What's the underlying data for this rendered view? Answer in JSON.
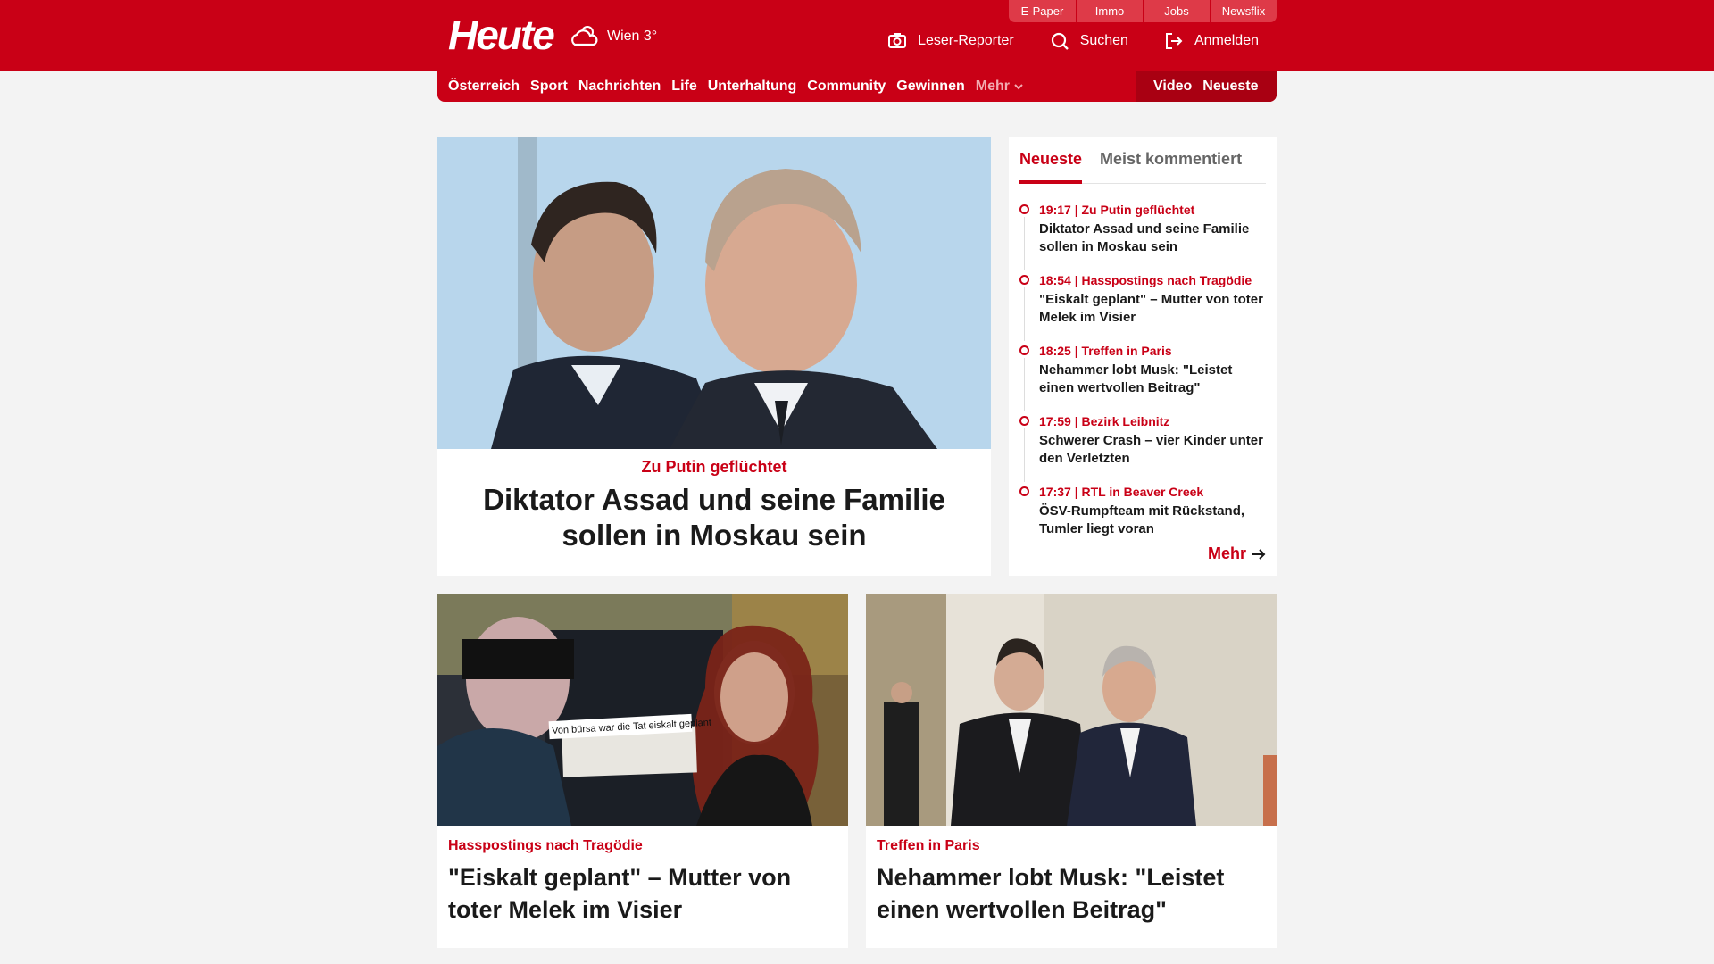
{
  "header": {
    "logo": "Heute",
    "weather": "Wien 3°",
    "quicklinks": [
      "E-Paper",
      "Immo",
      "Jobs",
      "Newsflix"
    ],
    "actions": [
      {
        "label": "Leser-Reporter",
        "icon": "camera-icon"
      },
      {
        "label": "Suchen",
        "icon": "search-icon"
      },
      {
        "label": "Anmelden",
        "icon": "login-icon"
      }
    ]
  },
  "nav": {
    "items": [
      "Österreich",
      "Sport",
      "Nachrichten",
      "Life",
      "Unterhaltung",
      "Community",
      "Gewinnen"
    ],
    "more": "Mehr",
    "right": [
      "Video",
      "Neueste"
    ]
  },
  "hero": {
    "kicker": "Zu Putin geflüchtet",
    "headline": "Diktator Assad und seine Familie sollen in Moskau sein"
  },
  "sidebar": {
    "tabs": [
      "Neueste",
      "Meist kommentiert"
    ],
    "items": [
      {
        "meta": "19:17 | Zu Putin geflüchtet",
        "title": "Diktator Assad und seine Familie sollen in Moskau sein"
      },
      {
        "meta": "18:54 | Hasspostings nach Tragödie",
        "title": "\"Eiskalt geplant\" – Mutter von toter Melek im Visier"
      },
      {
        "meta": "18:25 | Treffen in Paris",
        "title": "Nehammer lobt Musk: \"Leistet einen wertvollen Beitrag\""
      },
      {
        "meta": "17:59 | Bezirk Leibnitz",
        "title": "Schwerer Crash – vier Kinder unter den Verletzten"
      },
      {
        "meta": "17:37 | RTL in Beaver Creek",
        "title": "ÖSV-Rumpfteam mit Rückstand, Tumler liegt voran"
      }
    ],
    "more": "Mehr"
  },
  "cards": [
    {
      "kicker": "Hasspostings nach Tragödie",
      "headline": "\"Eiskalt geplant\" – Mutter von toter Melek im Visier",
      "image_caption": "Von bürsa war die Tat eiskalt geplant"
    },
    {
      "kicker": "Treffen in Paris",
      "headline": "Nehammer lobt Musk: \"Leistet einen wertvollen Beitrag\""
    }
  ],
  "colors": {
    "brand": "#c90016",
    "brand_dark": "#a90012",
    "quicklink": "#de3a48",
    "background": "#f3f3f3"
  }
}
